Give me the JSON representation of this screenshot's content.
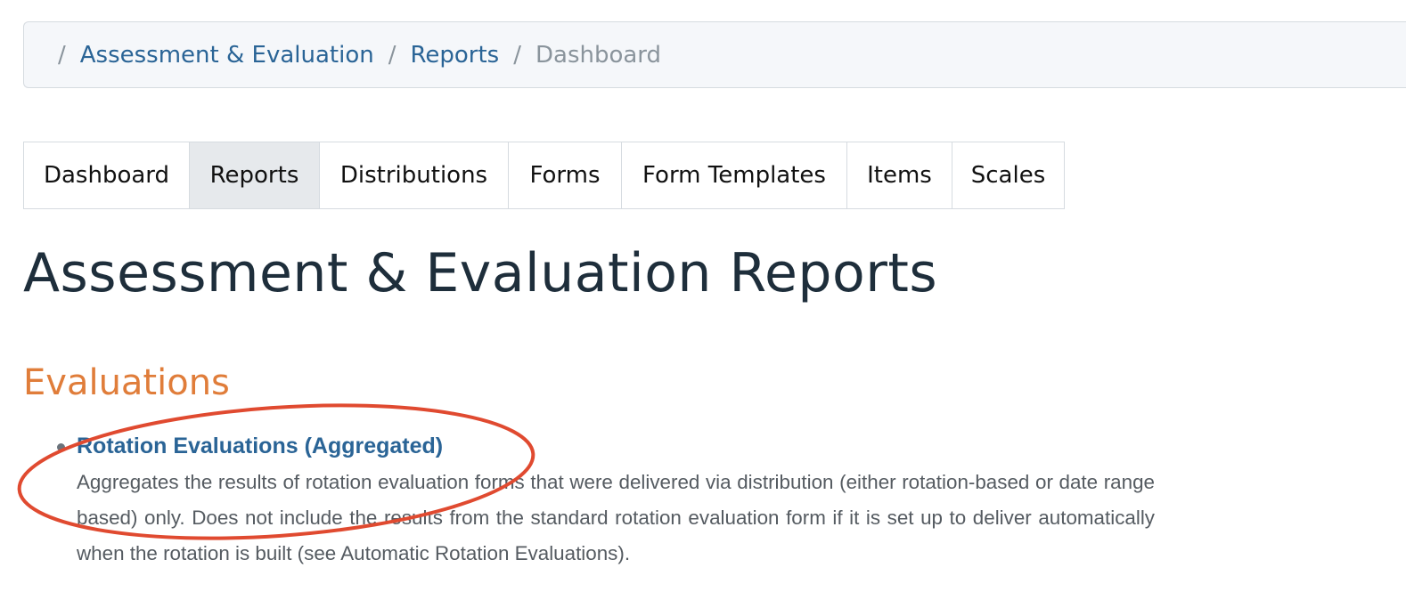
{
  "breadcrumb": {
    "separator": "/",
    "items": [
      {
        "label": "Assessment & Evaluation"
      },
      {
        "label": "Reports"
      },
      {
        "label": "Dashboard"
      }
    ]
  },
  "tabs": [
    {
      "label": "Dashboard",
      "active": false
    },
    {
      "label": "Reports",
      "active": true
    },
    {
      "label": "Distributions",
      "active": false
    },
    {
      "label": "Forms",
      "active": false
    },
    {
      "label": "Form Templates",
      "active": false
    },
    {
      "label": "Items",
      "active": false
    },
    {
      "label": "Scales",
      "active": false
    }
  ],
  "page_title": "Assessment & Evaluation Reports",
  "section": {
    "title": "Evaluations",
    "reports": [
      {
        "title": "Rotation Evaluations (Aggregated)",
        "description": "Aggregates the results of rotation evaluation forms that were delivered via distribution (either rotation-based or date range based) only. Does not include the results from the standard rotation evaluation form if it is set up to deliver automatically when the rotation is built (see Automatic Rotation Evaluations)."
      }
    ]
  },
  "colors": {
    "link": "#2a6496",
    "section_heading": "#e07d3a",
    "title": "#1e2e3b",
    "annotation": "#e04a30"
  }
}
